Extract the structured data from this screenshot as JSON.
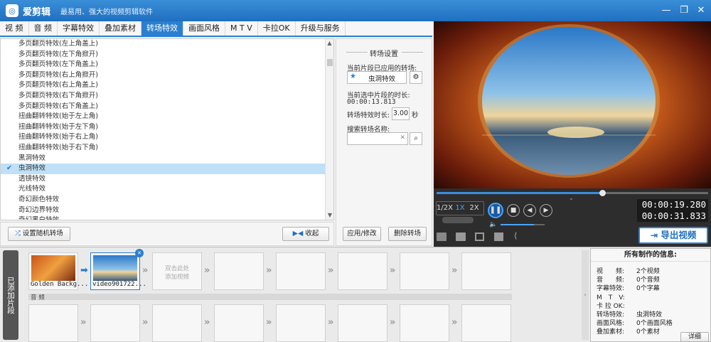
{
  "app": {
    "name": "爱剪辑",
    "tagline": "最易用、强大的视频剪辑软件"
  },
  "tabs": [
    "视 频",
    "音 频",
    "字幕特效",
    "叠加素材",
    "转场特效",
    "画面风格",
    "M T V",
    "卡拉OK",
    "升级与服务"
  ],
  "active_tab": "转场特效",
  "transitions": [
    "多页翻页特效(左上角盖上)",
    "多页翻页特效(左下角掀开)",
    "多页翻页特效(左下角盖上)",
    "多页翻页特效(右上角掀开)",
    "多页翻页特效(右上角盖上)",
    "多页翻页特效(右下角掀开)",
    "多页翻页特效(右下角盖上)",
    "扭曲翻转特效(始于左上角)",
    "扭曲翻转特效(始于左下角)",
    "扭曲翻转特效(始于右上角)",
    "扭曲翻转特效(始于右下角)",
    "黑洞特效",
    "虫洞特效",
    "透镜特效",
    "光线特效",
    "奇幻颜色特效",
    "奇幻边界特效",
    "奇幻黑白特效"
  ],
  "selected_transition": "虫洞特效",
  "buttons": {
    "random": "设置随机转场",
    "collapse": "收起",
    "apply": "应用/修改",
    "delete": "删除转场",
    "export": "导出视频"
  },
  "settings": {
    "title": "转场设置",
    "applied_label": "当前片段已应用的转场:",
    "applied_value": "虫洞特效",
    "duration_label": "当前选中片段的时长:",
    "duration_value": "00:00:13.813",
    "effect_duration_label": "转场特效时长:",
    "effect_duration_value": "3.00",
    "seconds": "秒",
    "search_label": "搜索转场名称:",
    "search_value": ""
  },
  "player": {
    "speeds": [
      "1/2X",
      "1X",
      "2X"
    ],
    "current_time": "00:00:19.280",
    "total_time": "00:00:31.833",
    "progress": 0.61,
    "volume": 0.75
  },
  "timeline": {
    "side_tab": "已添加片段",
    "clips": [
      {
        "label": "Golden Backg..."
      },
      {
        "label": "video901722..."
      }
    ],
    "empty_hint": "双击此处\n添加视频",
    "audio_label": "音 频"
  },
  "info": {
    "title": "所有制作的信息:",
    "rows": [
      {
        "k": "视　　频:",
        "v": "2个视频"
      },
      {
        "k": "音　　频:",
        "v": "0个音频"
      },
      {
        "k": "字幕特效:",
        "v": "0个字幕"
      },
      {
        "k": "M　T　V:",
        "v": ""
      },
      {
        "k": "卡 拉 OK:",
        "v": ""
      },
      {
        "k": "转场特效:",
        "v": "虫洞特效"
      },
      {
        "k": "画面风格:",
        "v": "0个画面风格"
      },
      {
        "k": "叠加素材:",
        "v": "0个素材"
      }
    ],
    "detail": "详细"
  },
  "colors": {
    "accent": "#2b7fd0",
    "selected_row": "#bfe0f7"
  }
}
